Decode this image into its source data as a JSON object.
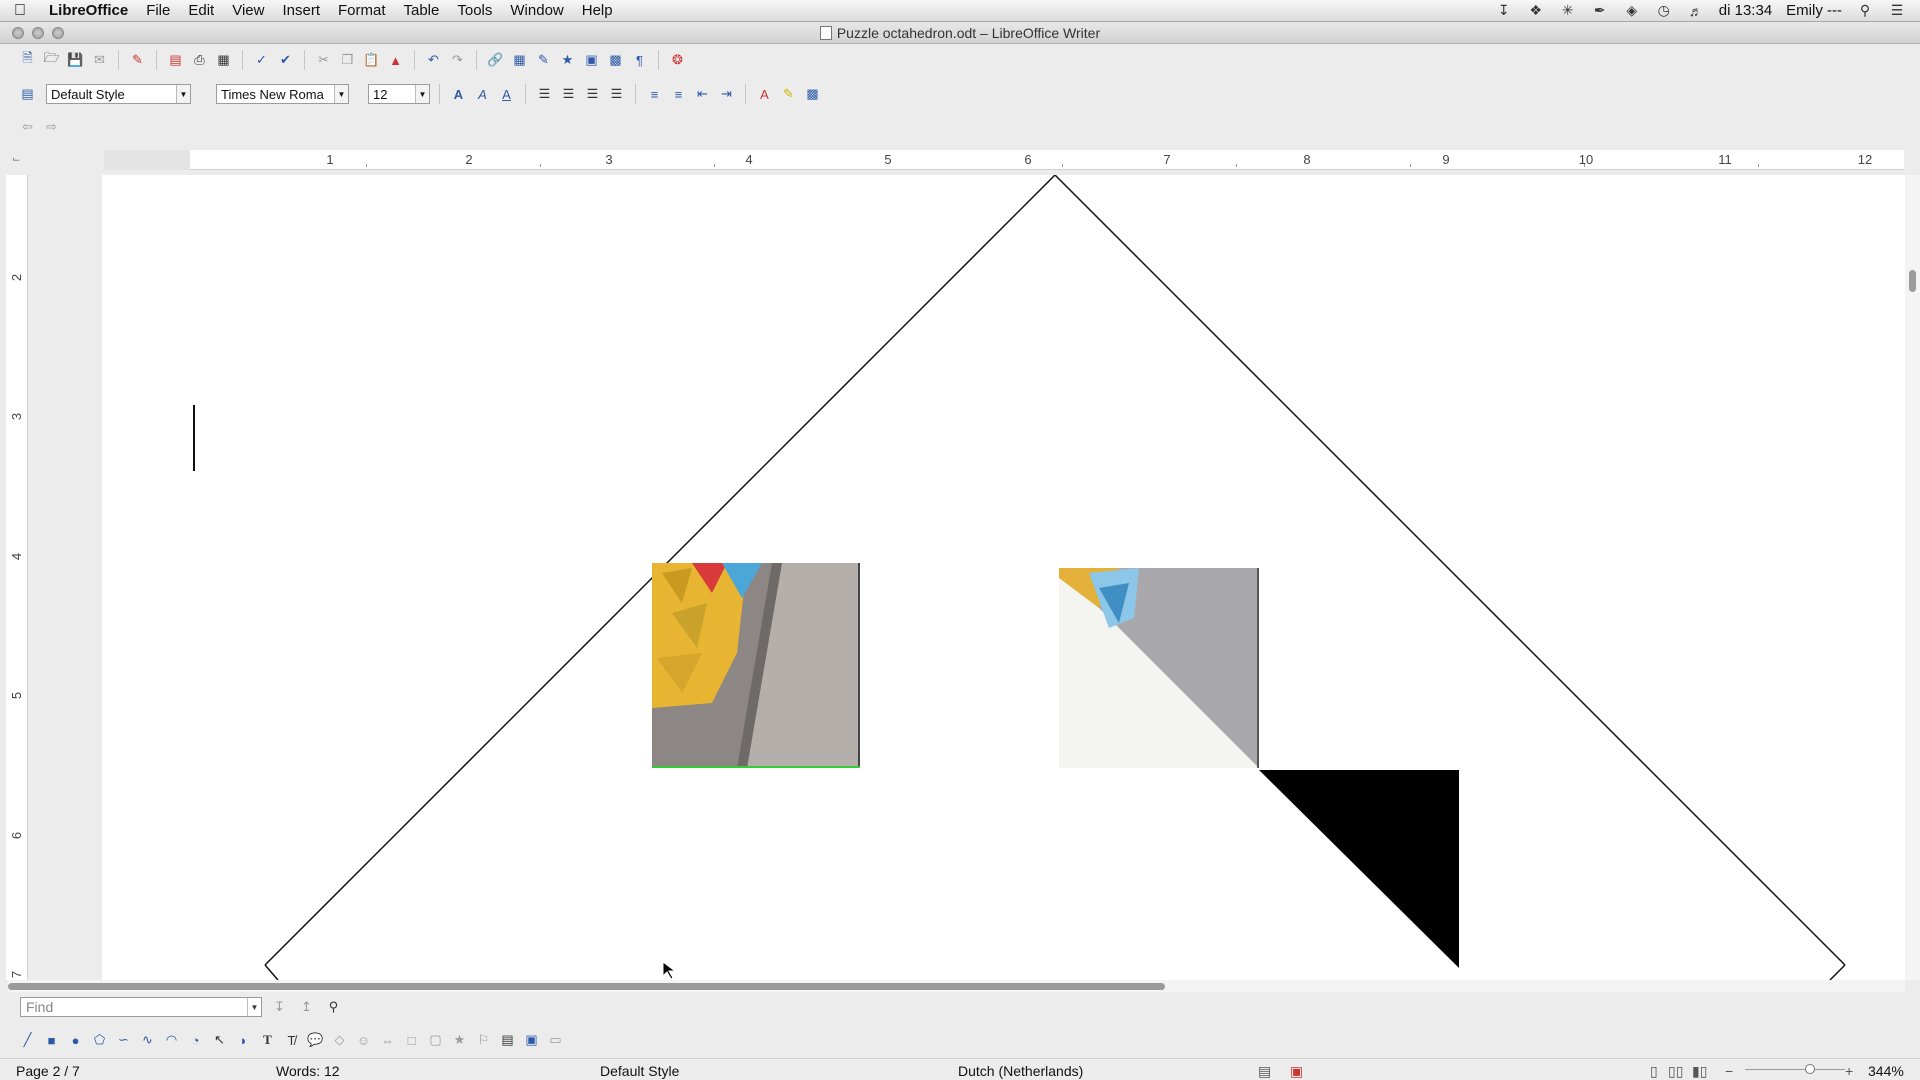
{
  "menubar": {
    "app_name": "LibreOffice",
    "menus": [
      "File",
      "Edit",
      "View",
      "Insert",
      "Format",
      "Table",
      "Tools",
      "Window",
      "Help"
    ],
    "clock": "di 13:34",
    "user": "Emily ---"
  },
  "window": {
    "title": "Puzzle octahedron.odt – LibreOffice Writer"
  },
  "formatting": {
    "paragraph_style": "Default Style",
    "font_name": "Times New Roma",
    "font_size": "12"
  },
  "ruler": {
    "horizontal_numbers": [
      "1",
      "2",
      "3",
      "4",
      "5",
      "6",
      "7",
      "8",
      "9",
      "10",
      "11",
      "12"
    ],
    "vertical_numbers": [
      "2",
      "3",
      "4",
      "5",
      "6",
      "7"
    ]
  },
  "find": {
    "placeholder": "Find"
  },
  "statusbar": {
    "page": "Page 2 / 7",
    "words": "Words: 12",
    "page_style": "Default Style",
    "language": "Dutch (Netherlands)",
    "zoom": "344%"
  },
  "colors": {
    "shape_fill": "#000000",
    "accent": "#2d5aa8"
  }
}
